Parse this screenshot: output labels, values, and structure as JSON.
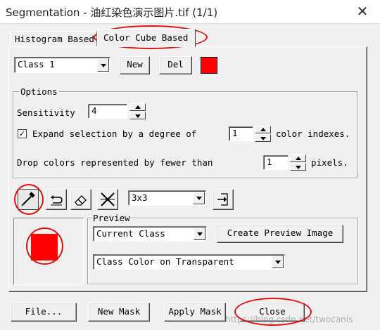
{
  "window": {
    "title": "Segmentation - 油红染色演示图片.tif (1/1)",
    "close_glyph": "✕"
  },
  "tabs": [
    {
      "label": "Histogram Based",
      "active": false
    },
    {
      "label": "Color Cube Based",
      "active": true
    }
  ],
  "class_row": {
    "selected_class": "Class 1",
    "new_label": "New",
    "del_label": "Del",
    "class_color": "#ff0000"
  },
  "options": {
    "group_label": "Options",
    "sensitivity_label": "Sensitivity",
    "sensitivity_value": "4",
    "expand_checked": true,
    "expand_label": "Expand selection by a degree of",
    "expand_value": "1",
    "expand_suffix": "color indexes.",
    "drop_label": "Drop colors represented by fewer than",
    "drop_value": "1",
    "drop_suffix": "pixels."
  },
  "tools": {
    "icons": [
      "eyedropper-icon",
      "undo-icon",
      "eraser-icon",
      "clear-icon",
      "export-icon"
    ],
    "kernel_size": "3x3"
  },
  "preview": {
    "group_label": "Preview",
    "source": "Current Class",
    "create_button": "Create Preview Image",
    "mode": "Class Color on Transparent",
    "swatch_color": "#ff0000"
  },
  "footer": {
    "file_button": "File...",
    "new_mask_button": "New Mask",
    "apply_mask_button": "Apply Mask",
    "close_button": "Close",
    "watermark": "https://blog.csdn.net/twocanis"
  },
  "annotation_color": "#e01010"
}
